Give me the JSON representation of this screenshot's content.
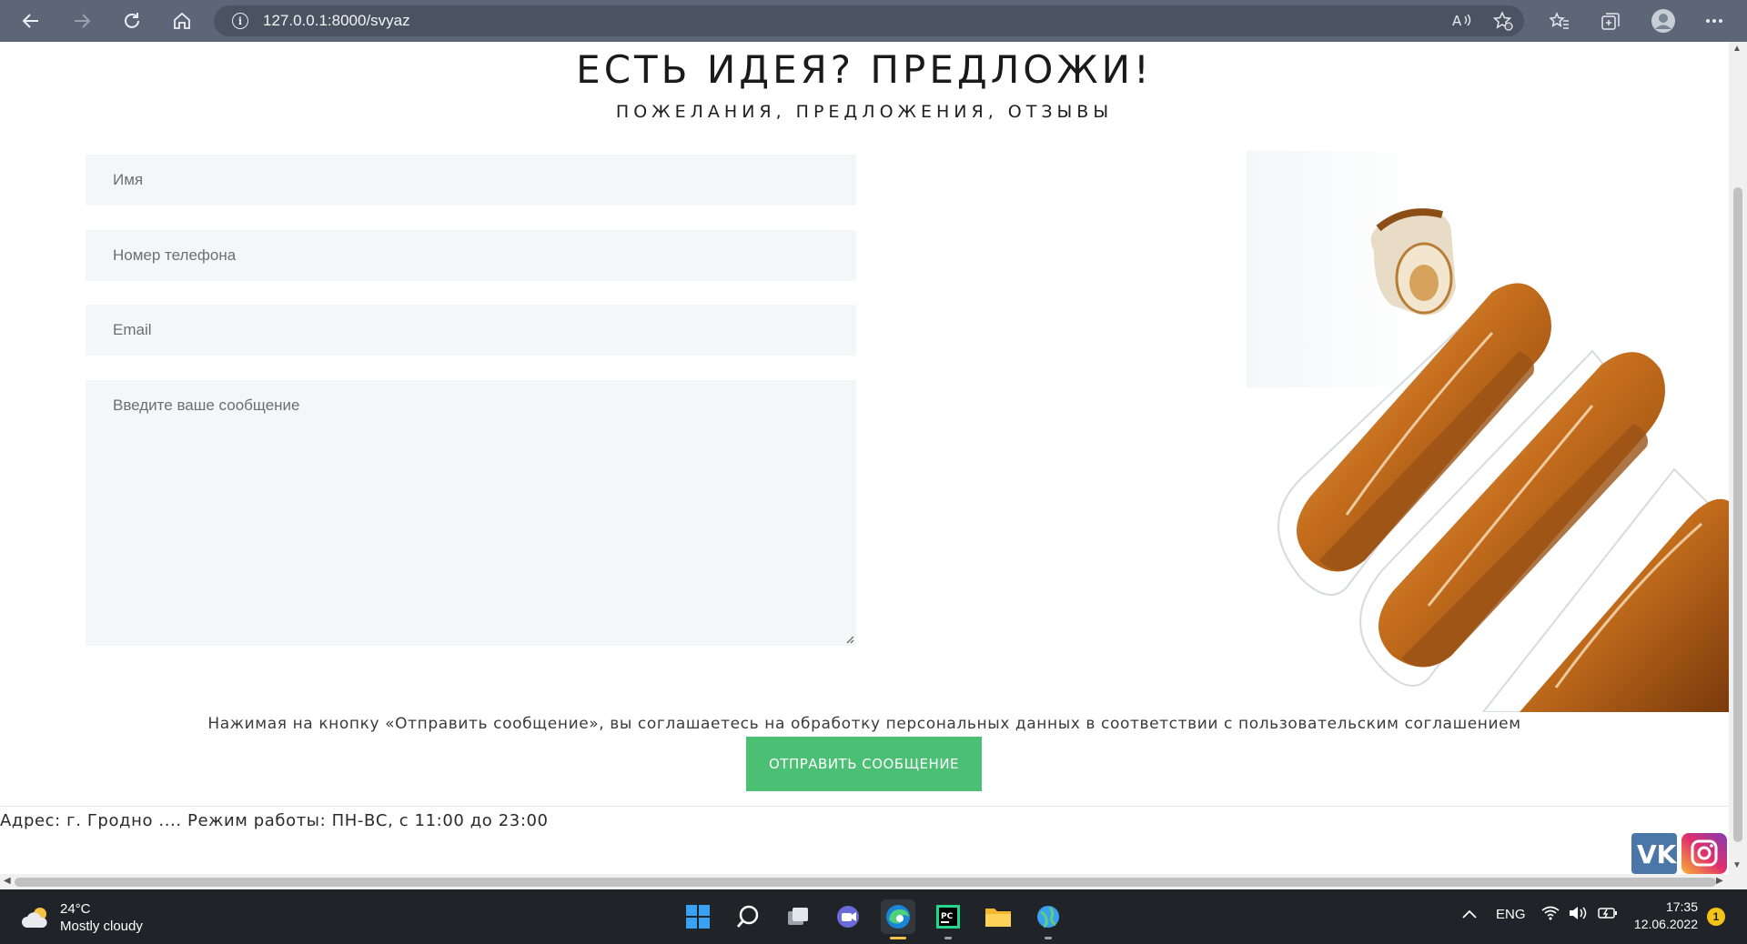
{
  "browser": {
    "url": "127.0.0.1:8000/svyaz"
  },
  "page": {
    "title": "ЕСТЬ ИДЕЯ? ПРЕДЛОЖИ!",
    "subtitle": "ПОЖЕЛАНИЯ, ПРЕДЛОЖЕНИЯ, ОТЗЫВЫ",
    "form": {
      "name_placeholder": "Имя",
      "phone_placeholder": "Номер телефона",
      "email_placeholder": "Email",
      "message_placeholder": "Введите ваше сообщение"
    },
    "consent_text": "Нажимая на кнопку «Отправить сообщение», вы соглашаетесь на обработку персональных данных в соответствии с пользовательским соглашением",
    "send_button": "ОТПРАВИТЬ СООБЩЕНИЕ",
    "footer": "Адрес: г. Гродно .... Режим работы: ПН-ВС, с 11:00 до 23:00",
    "social": [
      "vk-icon",
      "instagram-icon"
    ]
  },
  "taskbar": {
    "weather_temp": "24°C",
    "weather_desc": "Mostly cloudy",
    "language": "ENG",
    "time": "17:35",
    "date": "12.06.2022",
    "notification_count": "1",
    "apps": [
      "start-icon",
      "search-icon",
      "task-view-icon",
      "teams-chat-icon",
      "edge-icon",
      "pycharm-icon",
      "file-explorer-icon",
      "world-app-icon"
    ]
  },
  "colors": {
    "accent_button": "#4bbf73",
    "field_bg": "#f5f6f8",
    "chrome_bg": "#5c6676",
    "taskbar_bg": "#202328"
  }
}
